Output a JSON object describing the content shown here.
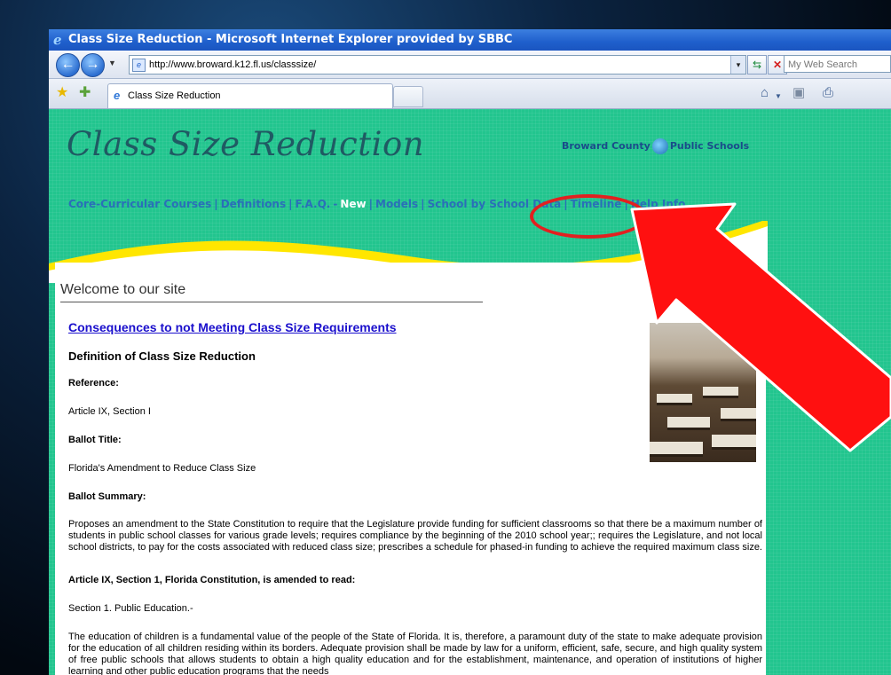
{
  "window": {
    "title": "Class Size Reduction - Microsoft Internet Explorer provided by SBBC"
  },
  "addressbar": {
    "url": "http://www.broward.k12.fl.us/classsize/",
    "search_placeholder": "My Web Search"
  },
  "tab": {
    "label": "Class Size Reduction"
  },
  "site": {
    "title": "Class Size Reduction",
    "county_left": "Broward County",
    "county_right": "Public Schools",
    "nav": {
      "core": "Core-Curricular Courses",
      "definitions": "Definitions",
      "faq": "F.A.Q.",
      "new": "New",
      "models": "Models",
      "school": "School by School Data",
      "timeline": "Timeline",
      "help": "Help Info"
    }
  },
  "page": {
    "welcome": "Welcome to our site",
    "consequences_link": "Consequences to not Meeting Class Size Requirements",
    "definition_heading": "Definition of Class Size Reduction",
    "reference_label": "Reference:",
    "reference_value": "Article IX, Section I",
    "ballot_title_label": "Ballot Title:",
    "ballot_title_value": "Florida's Amendment to Reduce Class Size",
    "ballot_summary_label": "Ballot Summary:",
    "ballot_summary_text": "Proposes an amendment to the State Constitution to require that the Legislature provide funding for sufficient classrooms so that there be a maximum number of students in public school classes for various grade levels; requires compliance by the beginning of the 2010 school year;; requires the Legislature, and not local school districts, to pay for the costs associated with reduced class size; prescribes a schedule for phased-in funding to achieve the required maximum class size.",
    "article_heading": "Article IX, Section 1, Florida Constitution, is amended to read:",
    "section_label": "Section 1. Public Education.-",
    "education_text": "The education of children is a fundamental value of the people of the State of Florida. It is, therefore, a paramount duty of the state to make adequate provision for the education of all children residing within its borders. Adequate provision shall be made by law for a uniform, efficient, safe, secure, and high quality system of free public schools that allows students to obtain a high quality education and for the establishment, maintenance, and operation of institutions of higher learning and other public education programs that the needs"
  },
  "colors": {
    "site_background": "#22c58e",
    "accent_red": "#e22020",
    "link_blue": "#1a0fcc"
  }
}
